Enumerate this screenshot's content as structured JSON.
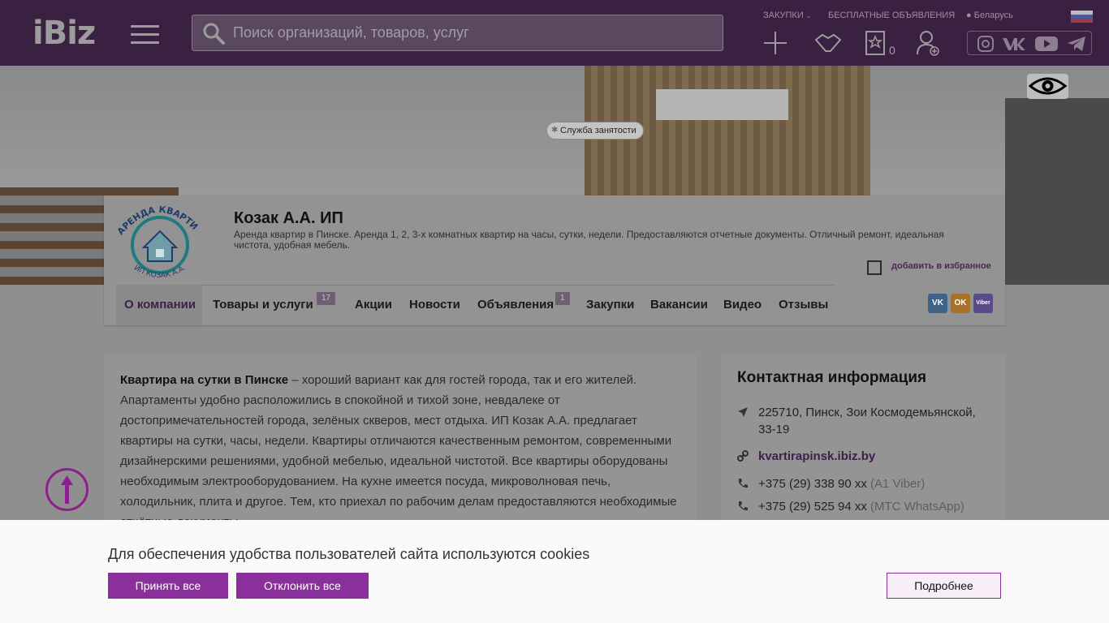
{
  "header": {
    "logo": "iBiz",
    "search_placeholder": "Поиск организаций, товаров, услуг",
    "links": {
      "purchases": "ЗАКУПКИ",
      "free_ads": "БЕСПЛАТНЫЕ ОБЪЯВЛЕНИЯ",
      "region": "Беларусь"
    },
    "favorites_count": "0",
    "icons": [
      "menu-icon",
      "search-icon",
      "plus-icon",
      "handshake-icon",
      "favorites-icon",
      "user-add-icon",
      "instagram-icon",
      "vk-icon",
      "youtube-icon",
      "telegram-icon"
    ]
  },
  "company": {
    "name": "Козак А.А. ИП",
    "description": "Аренда квартир в Пинске. Аренда 1, 2, 3-х комнатных квартир на часы, сутки, недели. Предоставляются отчетные документы. Отличный ремонт, идеальная чистота, удобная мебель.",
    "logo_top": "АРЕНДА КВАРТИР",
    "logo_bottom": "ИП КОЗАК А.А.",
    "favorite_label": "добавить в избранное"
  },
  "tabs": [
    {
      "label": "О компании",
      "badge": ""
    },
    {
      "label": "Товары и услуги",
      "badge": "17"
    },
    {
      "label": "Акции",
      "badge": ""
    },
    {
      "label": "Новости",
      "badge": ""
    },
    {
      "label": "Объявления",
      "badge": "1"
    },
    {
      "label": "Закупки",
      "badge": ""
    },
    {
      "label": "Вакансии",
      "badge": ""
    },
    {
      "label": "Видео",
      "badge": ""
    },
    {
      "label": "Отзывы",
      "badge": ""
    }
  ],
  "employment_service": "Служба занятости",
  "share": {
    "vk": "VK",
    "ok": "OK",
    "viber": "Viber"
  },
  "about": {
    "lead": "Квартира на сутки в Пинске",
    "text": " – хороший вариант как для гостей города, так и его жителей. Апартаменты удобно расположились в спокойной и тихой зоне, невдалеке от достопримечательностей города, зелёных скверов, мест отдыха.  ИП Козак А.А. предлагает квартиры на сутки, часы, недели. Квартиры отличаются качественным ремонтом, современными дизайнерскими решениями, удобной мебелью, идеальной чистотой.  Все квартиры оборудованы необходимым электрооборудованием. На кухне имеется посуда, микроволновая печь, холодильник, плита и другое. Тем, кто приехал по рабочим делам предоставляются необходимые отчётные документы."
  },
  "contacts": {
    "title": "Контактная информация",
    "address": "225710, Пинск, Зои Космодемьянской, 33-19",
    "site": "kvartirapinsk.ibiz.by",
    "phone1": "+375 (29) 338 90 xx",
    "phone1_note": "(A1 Viber)",
    "phone2": "+375 (29) 525 94 xx",
    "phone2_note": "(МТС WhatsApp)"
  },
  "cookie": {
    "text": "Для обеспечения удобства пользователей сайта используются cookies",
    "accept": "Принять все",
    "reject": "Отклонить все",
    "more": "Подробнее"
  },
  "colors": {
    "brand": "#8a2f9b",
    "header_bg": "#3b2141",
    "overlay": "#8f8f8f"
  }
}
